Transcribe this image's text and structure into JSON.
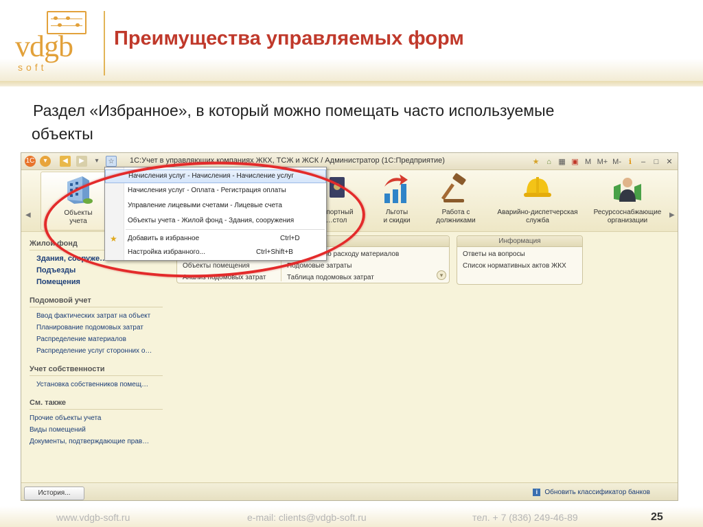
{
  "slide": {
    "logo_text": "vdgb",
    "logo_sub": "soft",
    "title": "Преимущества управляемых форм",
    "text_line1": "Раздел «Избранное», в который можно помещать часто используемые",
    "text_line2": "объекты"
  },
  "window": {
    "title": "1С:Учет в управляющих компаниях ЖКХ, ТСЖ и ЖСК / Администратор  (1С:Предприятие)",
    "title_controls": [
      "M",
      "M+",
      "M-"
    ],
    "toolbar": [
      {
        "label": "Объекты\nучета"
      },
      {
        "label": "…портный\n…стол"
      },
      {
        "label": "Льготы\nи скидки"
      },
      {
        "label": "Работа с\nдолжниками"
      },
      {
        "label": "Аварийно-диспетчерская\nслужба"
      },
      {
        "label": "Ресурсоснабжающие\nорганизации"
      }
    ],
    "sidebar": {
      "sec1": "Жилой фонд",
      "sec1_items": [
        "Здания, сооруже…",
        "Подъезды",
        "Помещения"
      ],
      "sec2": "Подомовой учет",
      "sec2_items": [
        "Ввод фактических затрат на объект",
        "Планирование подомовых затрат",
        "Распределение материалов",
        "Распределение услуг сторонних о…"
      ],
      "sec3": "Учет собственности",
      "sec3_items": [
        "Установка собственников помещ…"
      ],
      "sec4": "См. также",
      "sec4_items": [
        "Прочие объекты учета",
        "Виды помещений",
        "Документы, подтверждающие прав…"
      ]
    },
    "panel_reports": {
      "left_rows": [
        "Объекты помещения",
        "Анализ подомовых затрат"
      ],
      "right_rows": [
        "…й анализ по расходу материалов",
        "Подомовые затраты",
        "Таблица подомовых затрат"
      ]
    },
    "panel_info": {
      "header": "Информация",
      "rows": [
        "Ответы на вопросы",
        "Список нормативных актов ЖКХ"
      ]
    },
    "status": {
      "history": "История...",
      "link": "Обновить классификатор банков"
    }
  },
  "favorites_menu": {
    "items": [
      "Начисления услуг - Начисления - Начисление услуг",
      "Начисления услуг - Оплата - Регистрация оплаты",
      "Управление лицевыми счетами - Лицевые счета",
      "Объекты учета - Жилой фонд - Здания, сооружения"
    ],
    "add": "Добавить в избранное",
    "add_shortcut": "Ctrl+D",
    "settings": "Настройка избранного...",
    "settings_shortcut": "Ctrl+Shift+B"
  },
  "footer": {
    "site": "www.vdgb-soft.ru",
    "email": "e-mail: clients@vdgb-soft.ru",
    "phone": "тел. + 7 (836) 249-46-89",
    "page": "25"
  },
  "colors": {
    "title": "#c0392b",
    "logo": "#e2a13a",
    "highlight": "#e32b2b"
  }
}
